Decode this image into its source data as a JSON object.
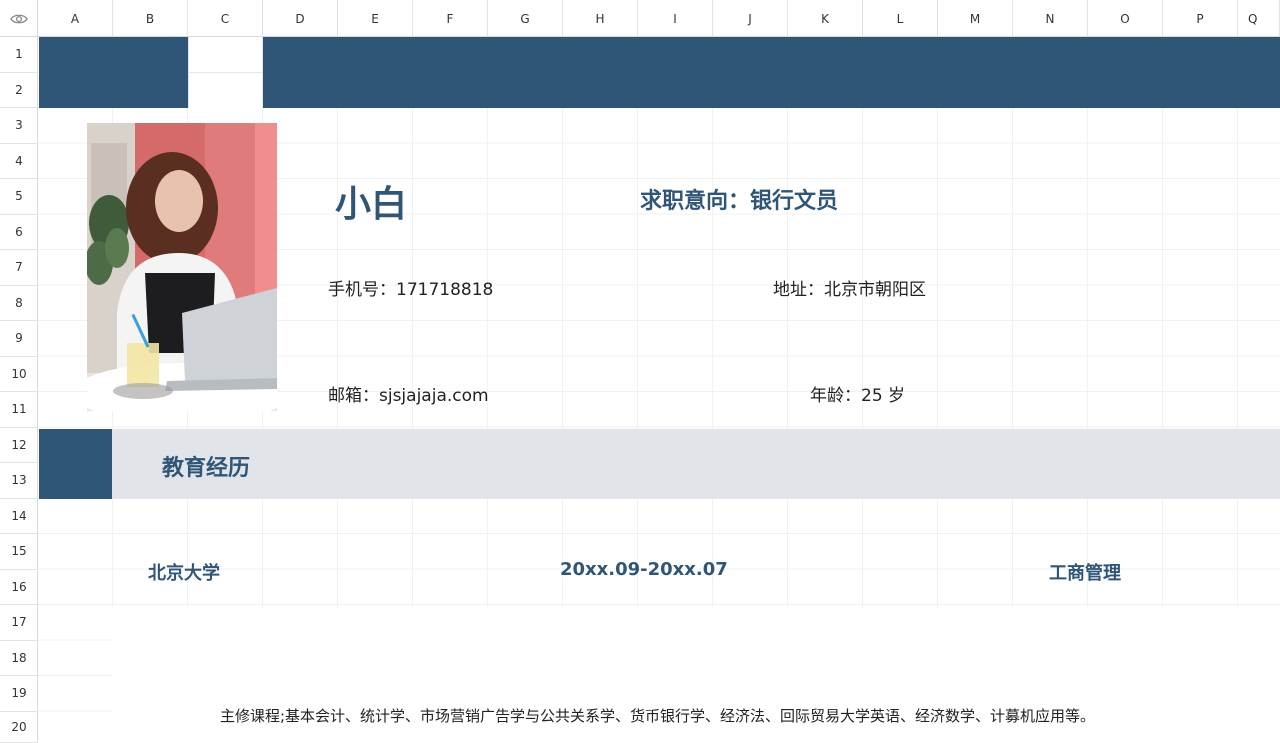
{
  "columns": [
    "A",
    "B",
    "C",
    "D",
    "E",
    "F",
    "G",
    "H",
    "I",
    "J",
    "K",
    "L",
    "M",
    "N",
    "O",
    "P",
    "Q"
  ],
  "rows": [
    "1",
    "2",
    "3",
    "4",
    "5",
    "6",
    "7",
    "8",
    "9",
    "10",
    "11",
    "12",
    "13",
    "14",
    "15",
    "16",
    "17",
    "18",
    "19",
    "20"
  ],
  "resume": {
    "name": "小白",
    "job_intent": "求职意向：银行文员",
    "phone": "手机号：171718818",
    "address": "地址：北京市朝阳区",
    "email": "邮箱：sjsjajaja.com",
    "age": "年龄：25 岁"
  },
  "education": {
    "section_title": "教育经历",
    "school": "北京大学",
    "period": "20xx.09-20xx.07",
    "major": "工商管理",
    "courses": "主修课程;基本会计、统计学、市场营销广告学与公共关系学、货币银行学、经济法、回际贸易大学英语、经济数学、计募机应用等。"
  },
  "colors": {
    "accent": "#305677",
    "section_bg": "#e1e5ea",
    "grid_line": "#f1f1f1"
  },
  "icons": {
    "corner": "eye-icon"
  }
}
